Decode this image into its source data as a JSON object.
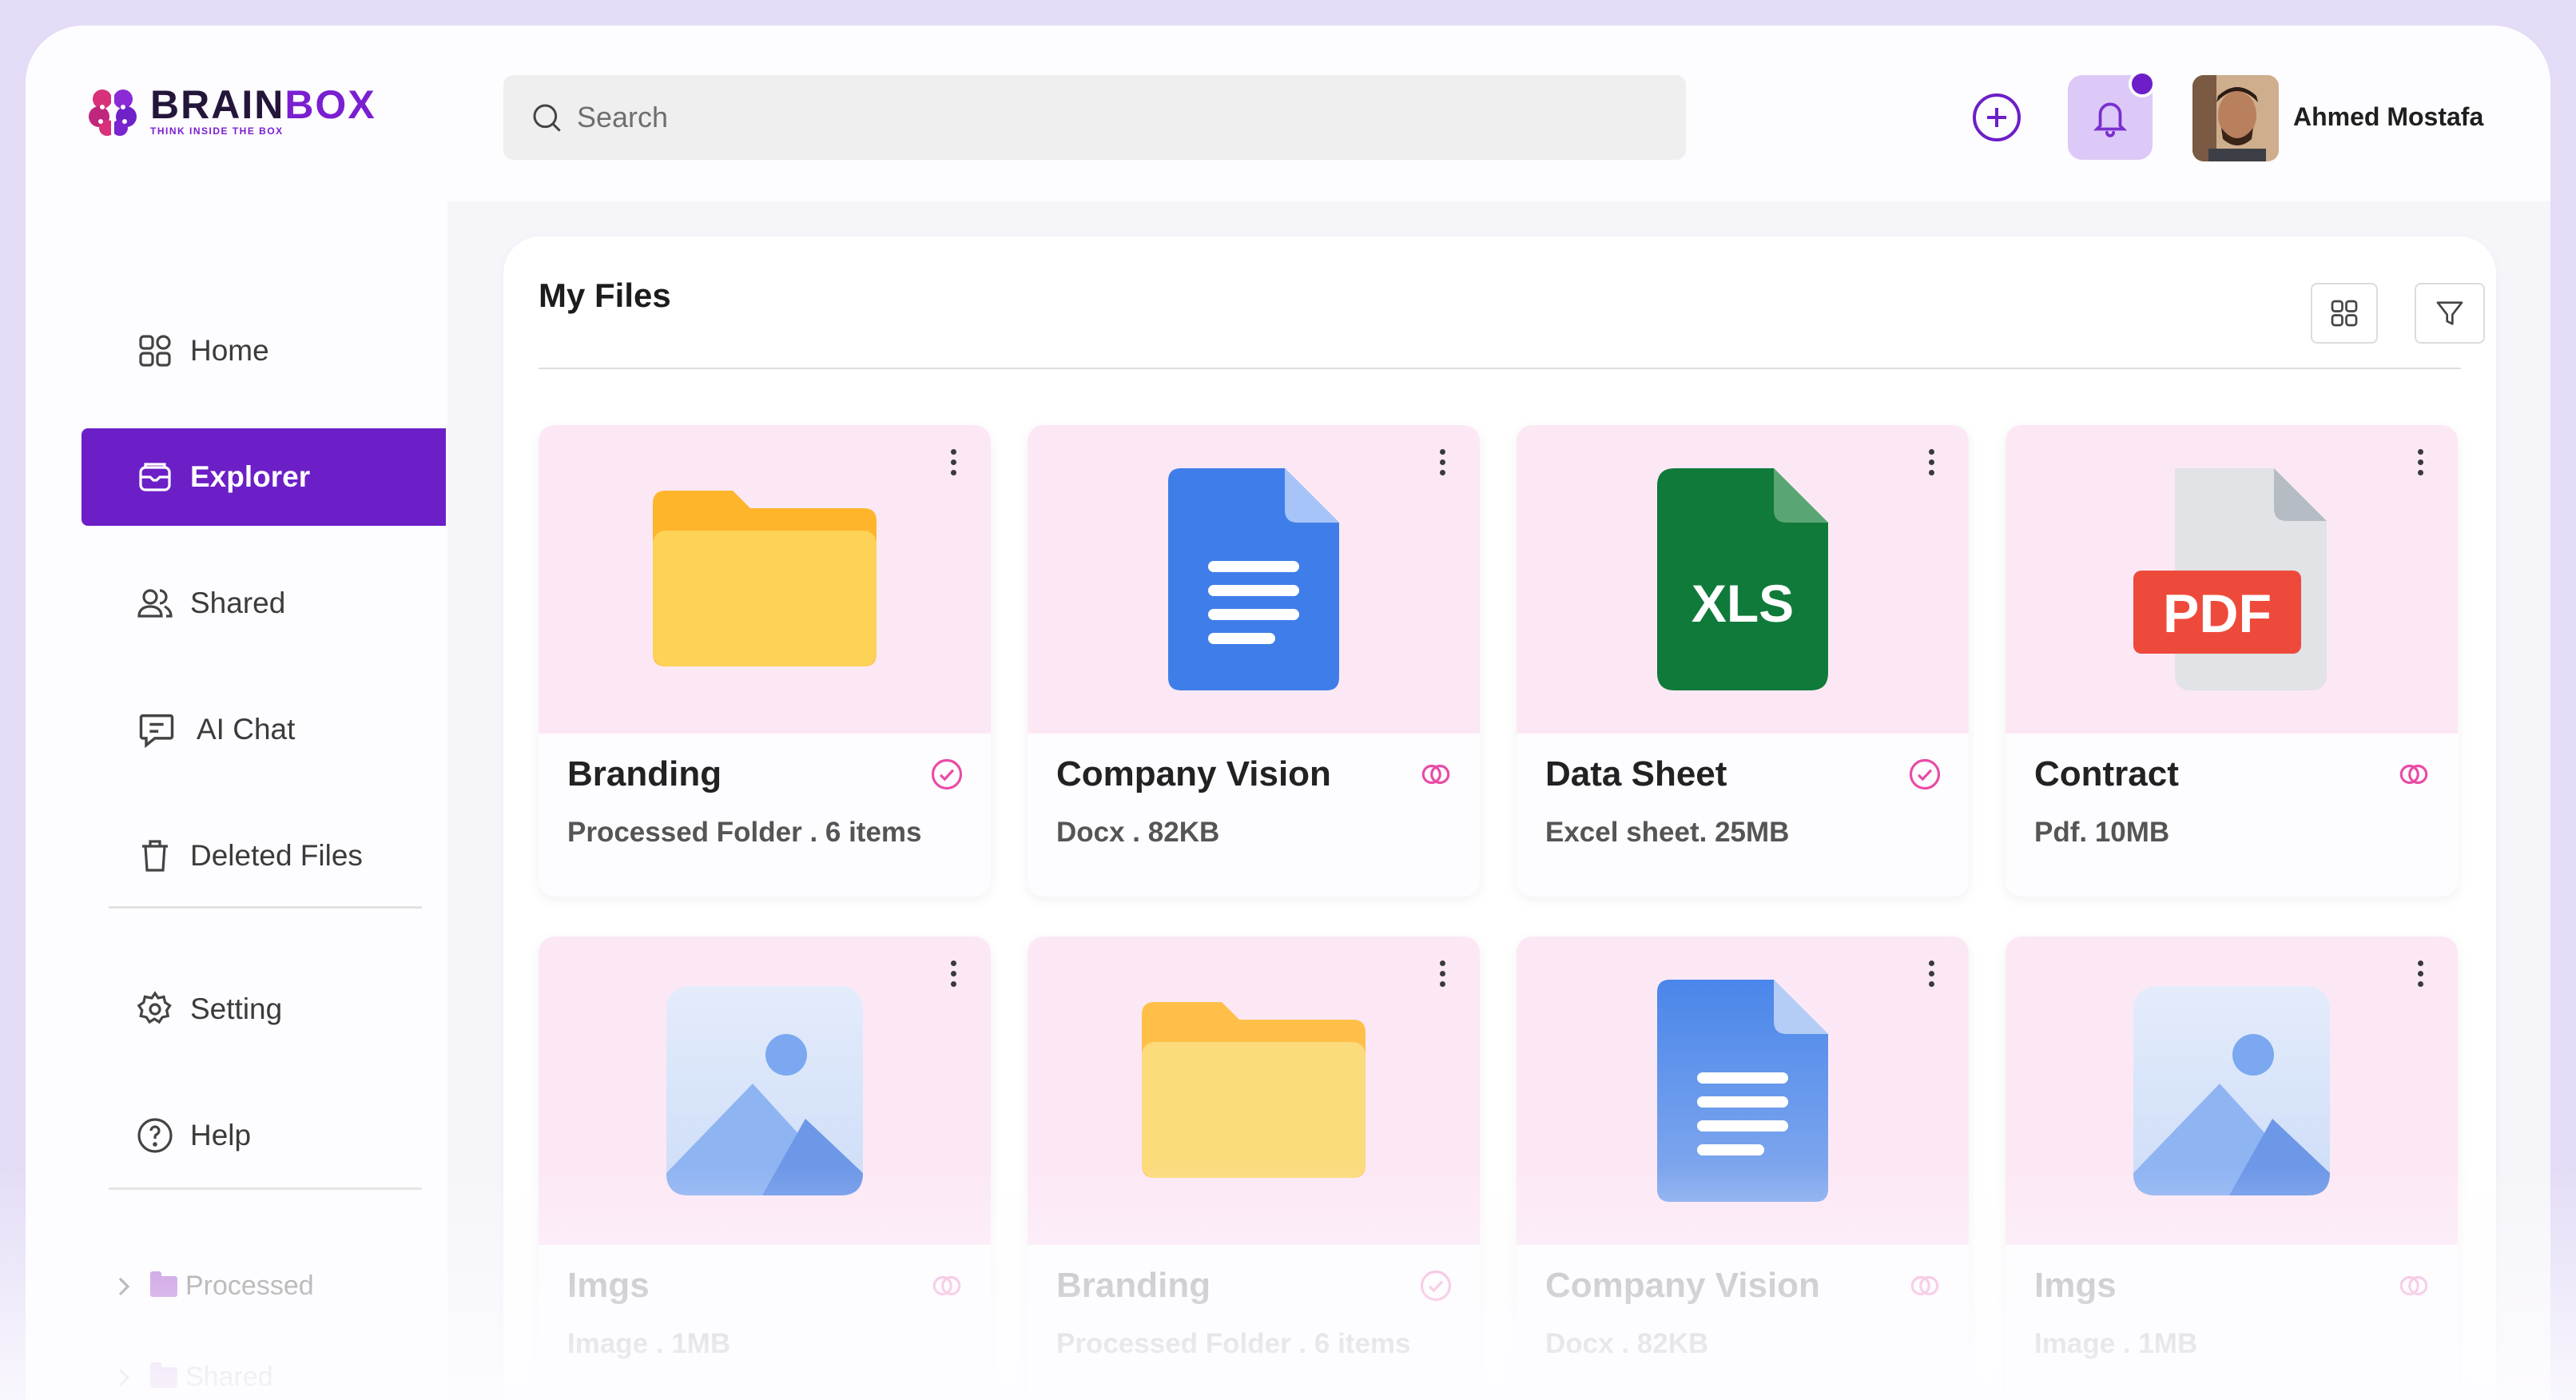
{
  "brand": {
    "name_part1": "BRAIN",
    "name_part2": "BOX",
    "tagline": "THINK INSIDE THE BOX"
  },
  "search": {
    "placeholder": "Search",
    "value": ""
  },
  "user": {
    "name": "Ahmed Mostafa",
    "has_notification": true
  },
  "sidebar": {
    "items": [
      {
        "label": "Home",
        "icon": "grid-icon",
        "active": false
      },
      {
        "label": "Explorer",
        "icon": "folder-open-icon",
        "active": true
      },
      {
        "label": "Shared",
        "icon": "users-icon",
        "active": false
      },
      {
        "label": "AI Chat",
        "icon": "chat-icon",
        "active": false
      },
      {
        "label": "Deleted Files",
        "icon": "trash-icon",
        "active": false
      }
    ],
    "secondary": [
      {
        "label": "Setting",
        "icon": "gear-icon"
      },
      {
        "label": "Help",
        "icon": "help-icon"
      }
    ],
    "tree": [
      {
        "label": "Processed"
      },
      {
        "label": "Shared"
      }
    ]
  },
  "main": {
    "title": "My Files",
    "files": [
      {
        "name": "Branding",
        "meta": "Processed Folder . 6 items",
        "type": "folder",
        "status": "check-icon"
      },
      {
        "name": "Company Vision",
        "meta": "Docx . 82KB",
        "type": "doc",
        "status": "link-icon"
      },
      {
        "name": "Data Sheet",
        "meta": "Excel sheet. 25MB",
        "type": "xls",
        "status": "check-icon",
        "badge": "XLS"
      },
      {
        "name": "Contract",
        "meta": "Pdf. 10MB",
        "type": "pdf",
        "status": "link-icon",
        "badge": "PDF"
      },
      {
        "name": "Imgs",
        "meta": "Image . 1MB",
        "type": "image",
        "status": "link-icon"
      },
      {
        "name": "Branding",
        "meta": "Processed Folder . 6 items",
        "type": "folder",
        "status": "check-icon"
      },
      {
        "name": "Company Vision",
        "meta": "Docx . 82KB",
        "type": "doc",
        "status": "link-icon"
      },
      {
        "name": "Imgs",
        "meta": "Image . 1MB",
        "type": "image",
        "status": "link-icon"
      }
    ]
  },
  "colors": {
    "accent": "#6c1fc6",
    "pink": "#e94ba6",
    "thumb_bg": "#fce8f5"
  }
}
